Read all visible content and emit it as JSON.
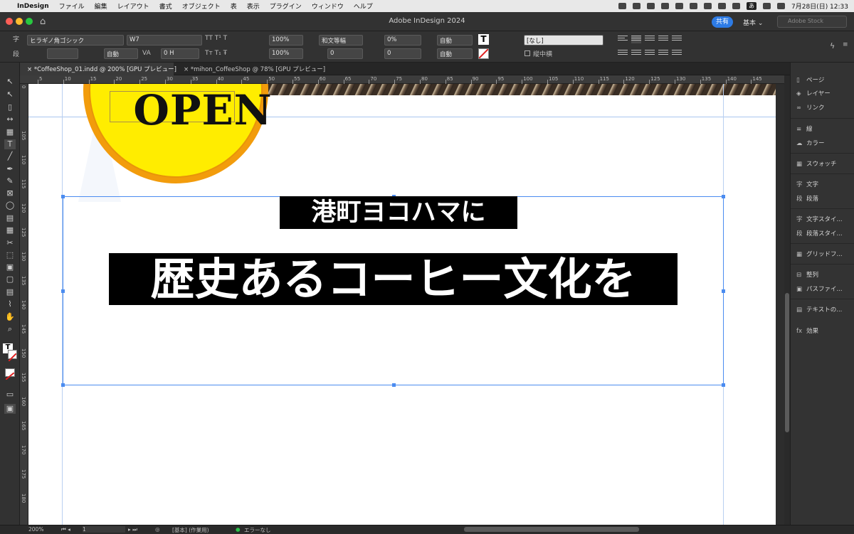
{
  "menubar": {
    "app": "InDesign",
    "items": [
      "ファイル",
      "編集",
      "レイアウト",
      "書式",
      "オブジェクト",
      "表",
      "表示",
      "プラグイン",
      "ウィンドウ",
      "ヘルプ"
    ],
    "ime": "あ",
    "datetime": "7月28日(日)  12:33"
  },
  "titlebar": {
    "title": "Adobe InDesign 2024",
    "share": "共有",
    "workspace": "基本 ⌄",
    "stock_placeholder": "Adobe Stock"
  },
  "control": {
    "char_icon": "字",
    "para_icon": "段",
    "font": "ヒラギノ角ゴシック",
    "weight": "W7",
    "size": "",
    "leading": "自動",
    "kerning_label": "VA",
    "tracking": "0 H",
    "scale_v": "100%",
    "scale_h": "100%",
    "mojikumi": "和文等幅",
    "tsume": "0%",
    "kerning": "0",
    "baseline": "0",
    "auto1": "自動",
    "auto2": "自動",
    "char_style": "[なし]",
    "tatechuyoko": "縦中横"
  },
  "tabs": [
    {
      "label": "*CoffeeShop_01.indd @ 200% [GPU プレビュー]"
    },
    {
      "label": "*mihon_CoffeeShop @ 78% [GPU プレビュー]"
    }
  ],
  "ruler": {
    "h": [
      "5",
      "10",
      "15",
      "20",
      "25",
      "30",
      "35",
      "40",
      "45",
      "50",
      "55",
      "60",
      "65",
      "70",
      "75",
      "80",
      "85",
      "90",
      "95",
      "100",
      "105",
      "110",
      "115",
      "120",
      "125",
      "130",
      "135",
      "140",
      "145"
    ],
    "v": [
      "0",
      "105",
      "110",
      "115",
      "120",
      "125",
      "130",
      "135",
      "140",
      "145",
      "150",
      "155",
      "160",
      "165",
      "170",
      "175",
      "180"
    ]
  },
  "canvas": {
    "badge_text": "OPEN",
    "line1": "港町ヨコハマに",
    "line2": "歴史あるコーヒー文化を"
  },
  "panels": [
    {
      "icon": "page-icon",
      "label": "ページ"
    },
    {
      "icon": "layers-icon",
      "label": "レイヤー"
    },
    {
      "icon": "links-icon",
      "label": "リンク"
    },
    {
      "icon": "stroke-icon",
      "label": "線"
    },
    {
      "icon": "color-icon",
      "label": "カラー"
    },
    {
      "icon": "swatches-icon",
      "label": "スウォッチ"
    },
    {
      "icon": "character-icon",
      "label": "文字"
    },
    {
      "icon": "paragraph-icon",
      "label": "段落"
    },
    {
      "icon": "char-style-icon",
      "label": "文字スタイ..."
    },
    {
      "icon": "para-style-icon",
      "label": "段落スタイ..."
    },
    {
      "icon": "grid-format-icon",
      "label": "グリッドフ..."
    },
    {
      "icon": "align-icon",
      "label": "整列"
    },
    {
      "icon": "pathfinder-icon",
      "label": "パスファイ..."
    },
    {
      "icon": "text-wrap-icon",
      "label": "テキストの..."
    },
    {
      "icon": "effects-icon",
      "label": "効果"
    }
  ],
  "status": {
    "zoom": "200%",
    "page": "1",
    "preflight_profile": "[基本] (作業用)",
    "errors": "エラーなし"
  },
  "colors": {
    "badge_yellow": "#ffed00",
    "badge_orange": "#f29c0c",
    "frame_blue": "#4b8cf0",
    "share_blue": "#2d7be5"
  }
}
